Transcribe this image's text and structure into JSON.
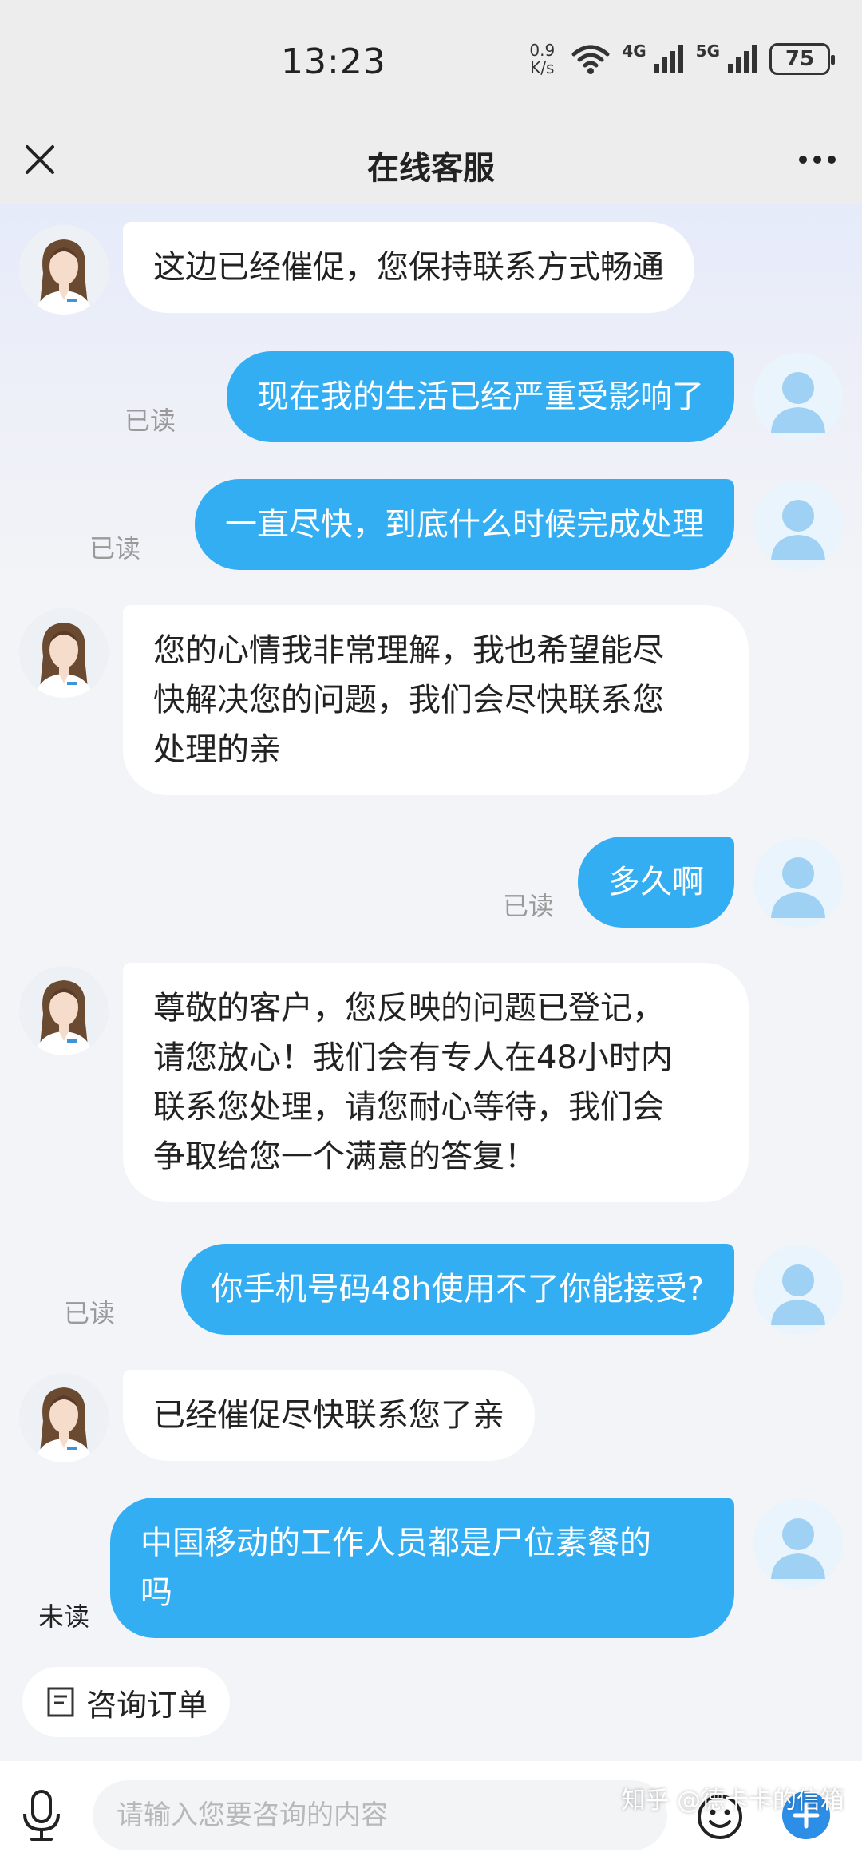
{
  "status_bar": {
    "time": "13:23",
    "net_speed_value": "0.9",
    "net_speed_unit": "K/s",
    "signal_1_label": "4G",
    "signal_2_label": "5G",
    "battery": "75"
  },
  "header": {
    "title": "在线客服"
  },
  "messages": [
    {
      "sender": "agent",
      "text": "这边已经催促，您保持联系方式畅通"
    },
    {
      "sender": "user",
      "text": "现在我的生活已经严重受影响了",
      "status": "已读"
    },
    {
      "sender": "user",
      "text": "一直尽快，到底什么时候完成处理",
      "status": "已读"
    },
    {
      "sender": "agent",
      "lines": [
        "您的心情我非常理解，我也希望能尽",
        "快解决您的问题，我们会尽快联系您",
        "处理的亲"
      ]
    },
    {
      "sender": "user",
      "text": "多久啊",
      "status": "已读"
    },
    {
      "sender": "agent",
      "lines": [
        "尊敬的客户，您反映的问题已登记，",
        "请您放心！我们会有专人在48小时内",
        "联系您处理，请您耐心等待，我们会",
        "争取给您一个满意的答复！"
      ]
    },
    {
      "sender": "user",
      "text": "你手机号码48h使用不了你能接受?",
      "status": "已读"
    },
    {
      "sender": "agent",
      "text": "已经催促尽快联系您了亲"
    },
    {
      "sender": "user",
      "lines": [
        "中国移动的工作人员都是尸位素餐的",
        "吗"
      ],
      "status": "未读"
    }
  ],
  "quick_actions": {
    "consult_order": "咨询订单"
  },
  "input": {
    "placeholder": "请输入您要咨询的内容"
  },
  "watermark": "知乎 @德卡卡的信箱",
  "colors": {
    "user_bubble": "#33aef3",
    "agent_bubble": "#ffffff",
    "accent_plus": "#2d8ee8",
    "unread_text": "#222222",
    "read_text": "#9a9a9a"
  },
  "icons": {
    "close": "close-icon",
    "more": "more-icon",
    "mic": "microphone-icon",
    "emoji": "emoji-icon",
    "plus": "plus-icon",
    "order": "document-icon"
  }
}
